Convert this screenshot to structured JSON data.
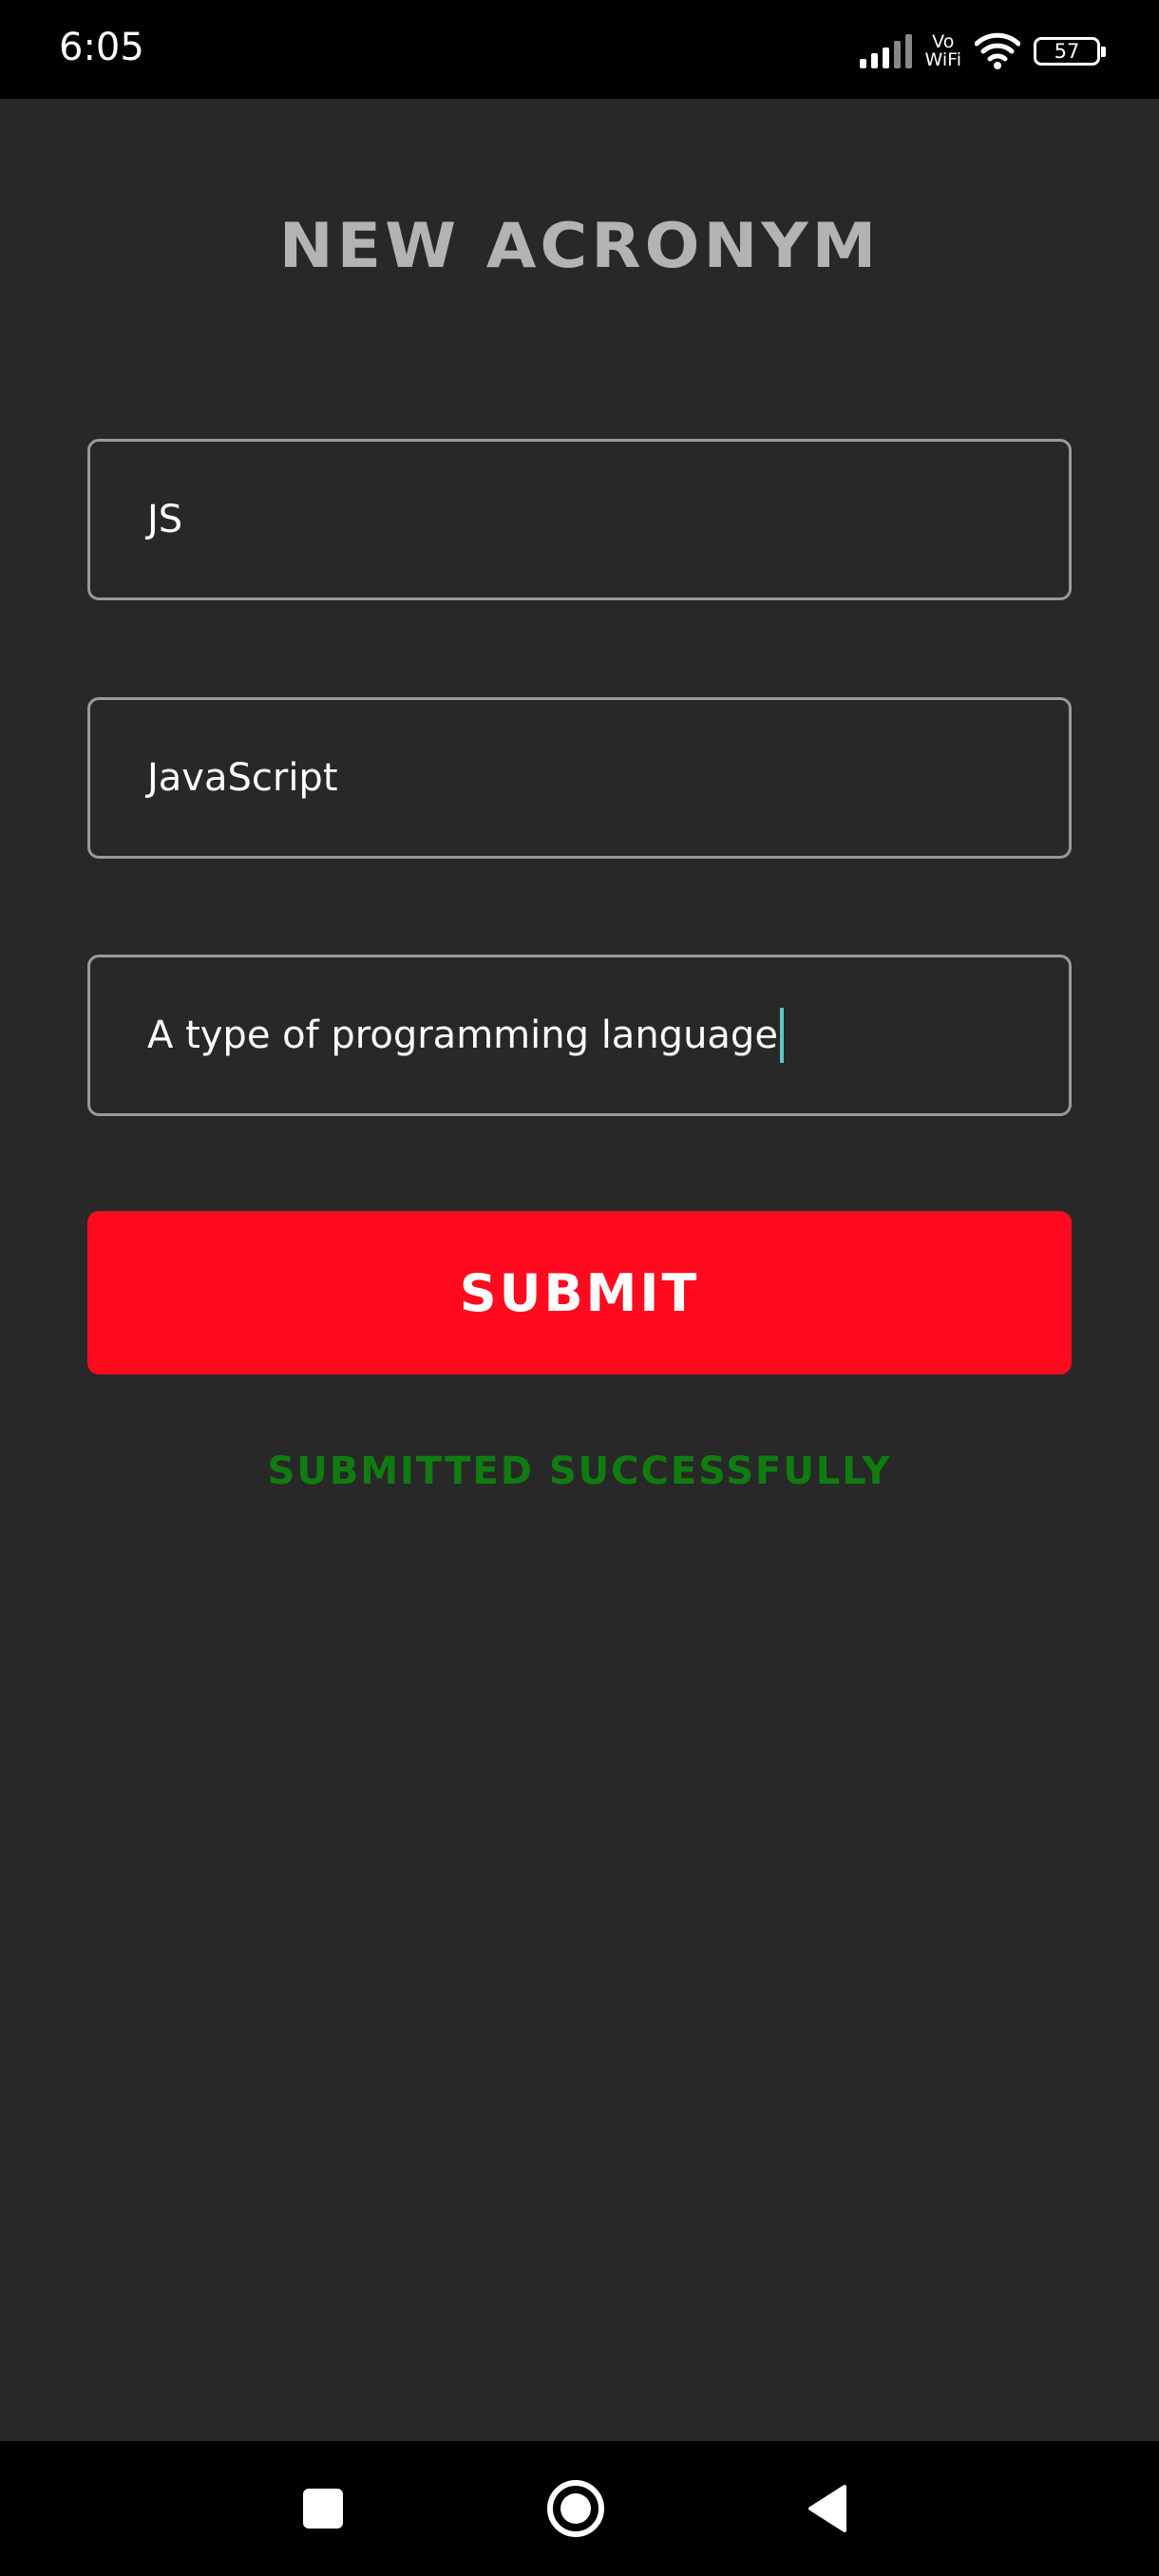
{
  "status_bar": {
    "time": "6:05",
    "network_label_top": "Vo",
    "network_label_bottom": "WiFi",
    "battery_level": "57",
    "icons": [
      "signal-icon",
      "vowifi-icon",
      "wifi-icon",
      "battery-icon"
    ]
  },
  "form": {
    "title": "New Acronym",
    "acronym_value": "JS",
    "full_form_value": "JavaScript",
    "description_value": "A type of programming language",
    "submit_label": "Submit",
    "status_message": "Submitted Successfully"
  },
  "nav_bar": {
    "icons": [
      "recents-square-icon",
      "home-circle-icon",
      "back-triangle-icon"
    ]
  },
  "colors": {
    "background": "#282828",
    "accent": "#ff0a1e",
    "success": "#107c10",
    "title": "#b3b3b3",
    "caret": "#5fc7c1"
  }
}
